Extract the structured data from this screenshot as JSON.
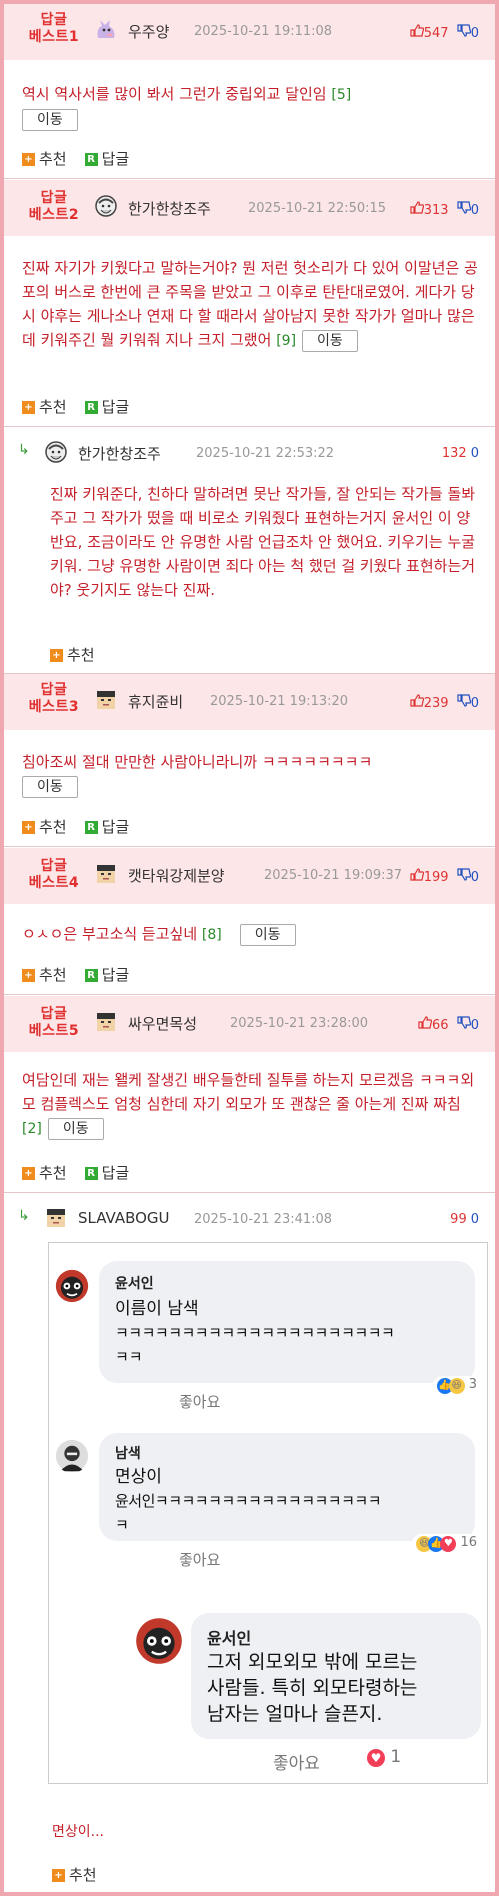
{
  "comments": [
    {
      "badge_line1": "답글",
      "badge_line2": "베스트1",
      "nick": "우주양",
      "date": "2025-10-21 19:11:08",
      "up": "547",
      "down": "0",
      "text": "역시 역사서를 많이 봐서 그런가 중립외교 달인임",
      "count": "[5]",
      "move": "이동",
      "recommend": "추천",
      "reply": "답글"
    },
    {
      "badge_line1": "답글",
      "badge_line2": "베스트2",
      "nick": "한가한창조주",
      "date": "2025-10-21 22:50:15",
      "up": "313",
      "down": "0",
      "text": "진짜 자기가 키웠다고 말하는거야? 뭔 저런 헛소리가 다 있어 이말년은 공포의 버스로 한번에 큰 주목을 받았고 그 이후로 탄탄대로였어. 게다가 당시 야후는 게나소나 연재 다 할 때라서 살아남지 못한 작가가 얼마나 많은데 키워주긴 뭘 키워줘 지나 크지 그랬어",
      "count": "[9]",
      "move": "이동",
      "recommend": "추천",
      "reply": "답글"
    },
    {
      "badge_line1": "답글",
      "badge_line2": "베스트3",
      "nick": "휴지쥰비",
      "date": "2025-10-21 19:13:20",
      "up": "239",
      "down": "0",
      "text": "침아조씨 절대 만만한 사람아니라니까 ㅋㅋㅋㅋㅋㅋㅋㅋ",
      "count": "",
      "move": "이동",
      "recommend": "추천",
      "reply": "답글"
    },
    {
      "badge_line1": "답글",
      "badge_line2": "베스트4",
      "nick": "캣타워강제분양",
      "date": "2025-10-21 19:09:37",
      "up": "199",
      "down": "0",
      "text": "ㅇㅅㅇ은 부고소식 듣고싶네",
      "count": "[8]",
      "move": "이동",
      "recommend": "추천",
      "reply": "답글"
    },
    {
      "badge_line1": "답글",
      "badge_line2": "베스트5",
      "nick": "싸우면목성",
      "date": "2025-10-21 23:28:00",
      "up": "66",
      "down": "0",
      "text": "여담인데 재는 왤케 잘생긴 배우들한테 질투를 하는지 모르겠음 ㅋㅋㅋ외모 컴플렉스도 엄청 심한데 자기 외모가 또 괜찮은 줄 아는게 진짜 짜침",
      "count": "[2]",
      "move": "이동",
      "recommend": "추천",
      "reply": "답글"
    }
  ],
  "reply1": {
    "nick": "한가한창조주",
    "date": "2025-10-21 22:53:22",
    "up": "132",
    "down": "0",
    "text": "진짜 키워준다, 친하다 말하려면 못난 작가들, 잘 안되는 작가들 돌봐주고 그 작가가 떴을 때 비로소 키워줬다 표현하는거지 윤서인 이 양반요, 조금이라도 안 유명한 사람 언급조차 안 했어요. 키우기는 누굴 키워. 그냥 유명한 사람이면 죄다 아는 척 했던 걸 키웠다 표현하는거야? 웃기지도 않는다 진짜.",
    "recommend": "추천"
  },
  "reply2": {
    "nick": "SLAVABOGU",
    "date": "2025-10-21 23:41:08",
    "up": "99",
    "down": "0",
    "caption": "면상이...",
    "recommend": "추천"
  },
  "fb": {
    "c1": {
      "name": "윤서인",
      "line1": "이름이 남색",
      "line2": "ㅋㅋㅋㅋㅋㅋㅋㅋㅋㅋㅋㅋㅋㅋㅋㅋㅋㅋㅋㅋㅋ",
      "line3": "ㅋㅋ",
      "like": "좋아요",
      "reacts": "3"
    },
    "c2": {
      "name": "남색",
      "line1": "면상이",
      "line2": "윤서인ㅋㅋㅋㅋㅋㅋㅋㅋㅋㅋㅋㅋㅋㅋㅋㅋㅋ",
      "line3": "ㅋ",
      "like": "좋아요",
      "reacts": "16"
    },
    "c3": {
      "name": "윤서인",
      "line1": "그저 외모외모 밖에 모르는",
      "line2": "사람들. 특히 외모타령하는",
      "line3": "남자는 얼마나 슬픈지.",
      "like": "좋아요",
      "reacts": "1"
    }
  },
  "colors": {
    "accent": "#e03030",
    "header_bg": "#fde6e8",
    "border": "#f0a8b0",
    "body_text": "#c41f2a",
    "count": "#2a8a2a",
    "up": "#dd3333",
    "down": "#2050c0"
  }
}
